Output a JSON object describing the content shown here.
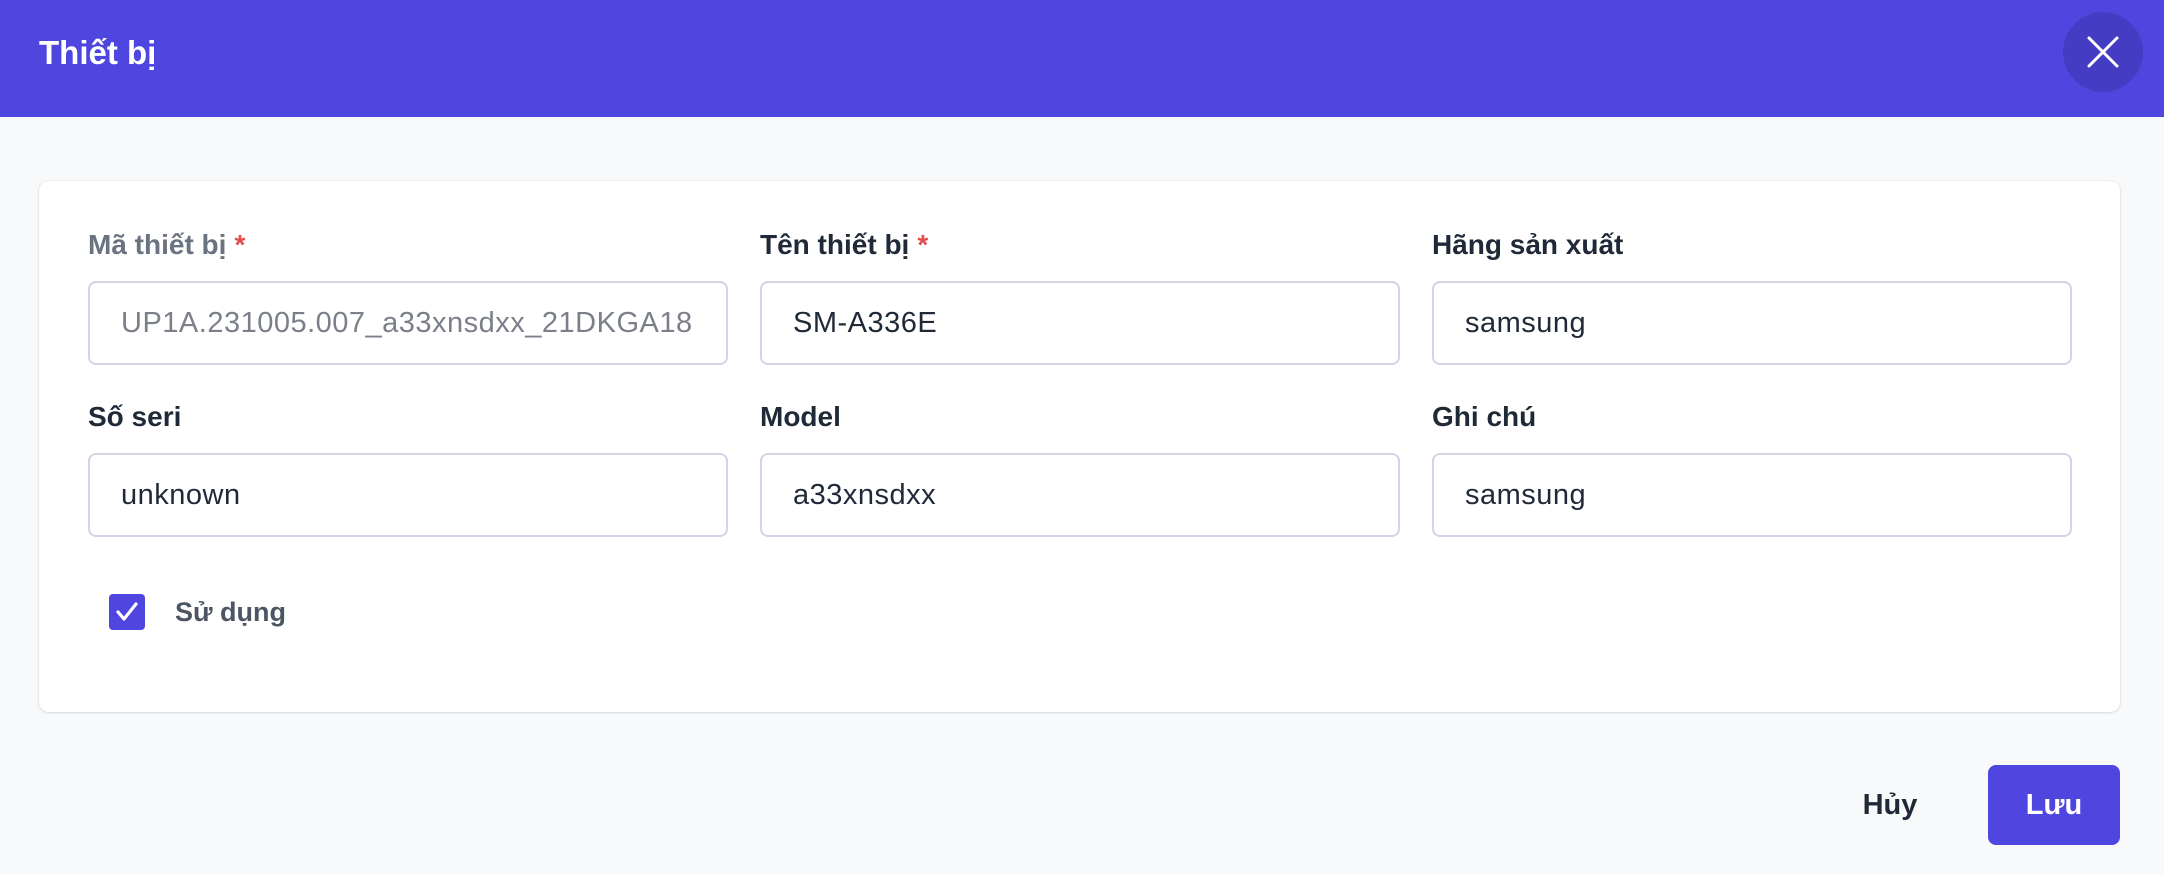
{
  "dialog": {
    "title": "Thiết bị"
  },
  "form": {
    "fields": [
      {
        "label": "Mã thiết bị",
        "required": "*",
        "value": "UP1A.231005.007_a33xnsdxx_21DKGA18"
      },
      {
        "label": "Tên thiết bị",
        "required": "*",
        "value": "SM-A336E"
      },
      {
        "label": "Hãng sản xuất",
        "value": "samsung"
      },
      {
        "label": "Số seri",
        "value": "unknown"
      },
      {
        "label": "Model",
        "value": "a33xnsdxx"
      },
      {
        "label": "Ghi chú",
        "value": "samsung"
      }
    ],
    "checkbox": {
      "label": "Sử dụng",
      "checked": true
    }
  },
  "footer": {
    "cancel_label": "Hủy",
    "save_label": "Lưu"
  },
  "icons": {
    "close": "close-icon",
    "check": "check-icon"
  },
  "colors": {
    "primary": "#4f46e0",
    "required": "#e24b4b"
  }
}
